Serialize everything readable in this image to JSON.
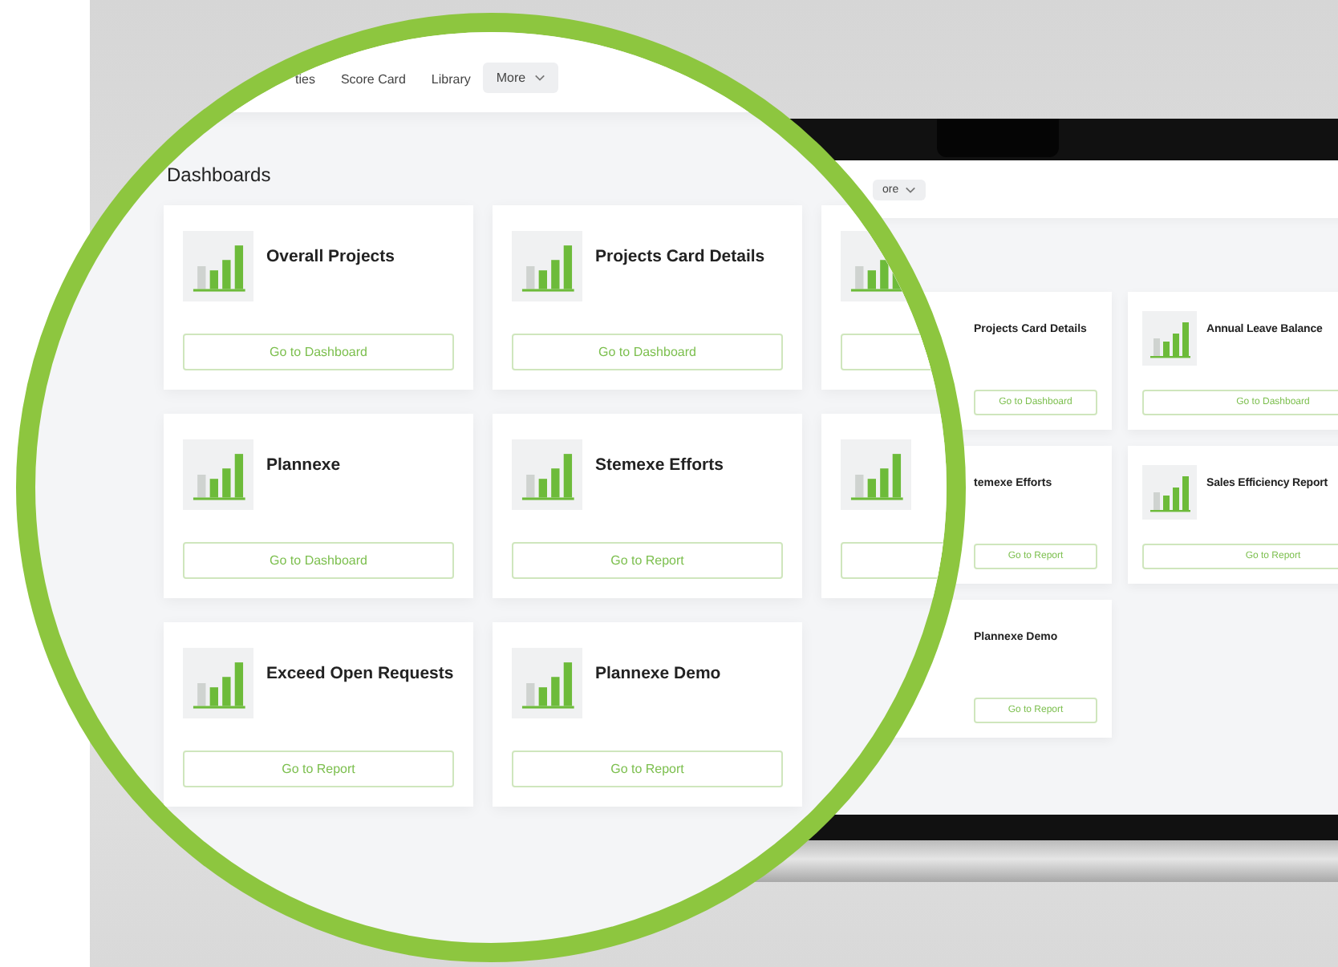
{
  "laptop": {
    "menu": {
      "label": "ore",
      "dropdown": true
    },
    "cards": [
      {
        "title": "Projects Card Details",
        "action": "Go to Dashboard"
      },
      {
        "title": "Annual Leave Balance",
        "action": "Go to Dashboard"
      },
      {
        "title": "temexe Efforts",
        "action": "Go to Report"
      },
      {
        "title": "Sales Efficiency Report",
        "action": "Go to Report"
      },
      {
        "title": "Plannexe Demo",
        "action": "Go to Report"
      }
    ]
  },
  "magnifier": {
    "nav": [
      {
        "label": "ties",
        "dropdown": false
      },
      {
        "label": "Score Card",
        "dropdown": false
      },
      {
        "label": "Library",
        "dropdown": false
      },
      {
        "label": "More",
        "dropdown": true
      }
    ],
    "heading": "Dashboards",
    "cards": [
      {
        "title": "Overall Projects",
        "action": "Go to Dashboard",
        "kind": "full"
      },
      {
        "title": "Projects Card Details",
        "action": "Go to Dashboard",
        "kind": "full"
      },
      {
        "kind": "clipped"
      },
      {
        "title": "Plannexe",
        "action": "Go to Dashboard",
        "kind": "full"
      },
      {
        "title": "Stemexe Efforts",
        "action": "Go to Report",
        "kind": "full"
      },
      {
        "kind": "clipped"
      },
      {
        "title": "Exceed Open Requests",
        "action": "Go to Report",
        "kind": "full"
      },
      {
        "title": "Plannexe Demo",
        "action": "Go to Report",
        "kind": "full"
      }
    ]
  }
}
